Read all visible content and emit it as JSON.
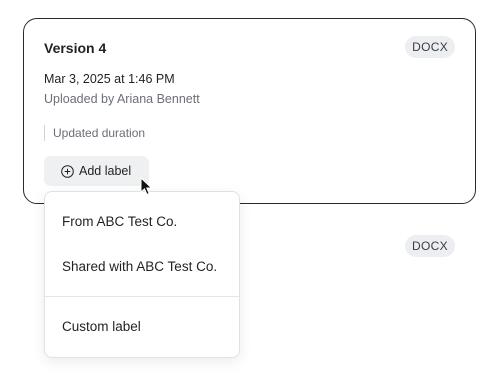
{
  "version_card": {
    "title": "Version 4",
    "file_type": "DOCX",
    "date": "Mar 3, 2025 at 1:46 PM",
    "uploader": "Uploaded by Ariana Bennett",
    "note": "Updated duration",
    "add_label_button": "Add label",
    "plus_icon": "plus-circle-icon"
  },
  "second_card": {
    "file_type": "DOCX"
  },
  "label_menu": {
    "items": [
      {
        "label": "From ABC Test Co."
      },
      {
        "label": "Shared with ABC Test Co."
      }
    ],
    "custom_item": {
      "label": "Custom label"
    }
  },
  "cursor_icon": "arrow-cursor-icon"
}
